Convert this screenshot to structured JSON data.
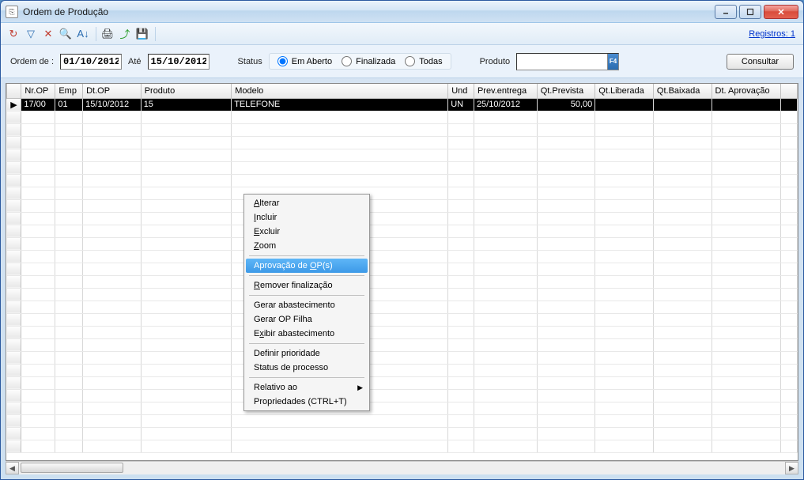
{
  "window": {
    "title": "Ordem de Produção"
  },
  "toolbar": {
    "records_label": "Registros: 1"
  },
  "filter": {
    "ordem_de_label": "Ordem de :",
    "ate_label": "Até",
    "date_from": "01/10/2012",
    "date_to": "15/10/2012",
    "status_label": "Status",
    "radio_em_aberto": "Em Aberto",
    "radio_finalizada": "Finalizada",
    "radio_todas": "Todas",
    "produto_label": "Produto",
    "produto_value": "",
    "consultar_label": "Consultar"
  },
  "columns": {
    "c0": "Nr.OP",
    "c1": "Emp",
    "c2": "Dt.OP",
    "c3": "Produto",
    "c4": "Modelo",
    "c5": "Und",
    "c6": "Prev.entrega",
    "c7": "Qt.Prevista",
    "c8": "Qt.Liberada",
    "c9": "Qt.Baixada",
    "c10": "Dt. Aprovação"
  },
  "rows": [
    {
      "nr_op": "17/00",
      "emp": "01",
      "dt_op": "15/10/2012",
      "produto": "15",
      "modelo": "TELEFONE",
      "und": "UN",
      "prev_entrega": "25/10/2012",
      "qt_prevista": "50,00",
      "qt_liberada": "",
      "qt_baixada": "",
      "dt_aprovacao": ""
    }
  ],
  "context_menu": {
    "alterar": "lterar",
    "incluir": "ncluir",
    "excluir": "xcluir",
    "zoom": "oom",
    "aprovacao": "Aprovação de ",
    "aprovacao_u": "O",
    "aprovacao_after": "P(s)",
    "remover": "emover finalização",
    "gerar_abast": "Gerar abastecimento",
    "gerar_op_filha": "Gerar OP Filha",
    "exibir_abast": "E",
    "exibir_abast_after": "ibir abastecimento",
    "definir_prio": "Definir prioridade",
    "status_proc": "Status de processo",
    "relativo": "Relativo ao",
    "propriedades": "Propriedades (CTRL+T)"
  }
}
